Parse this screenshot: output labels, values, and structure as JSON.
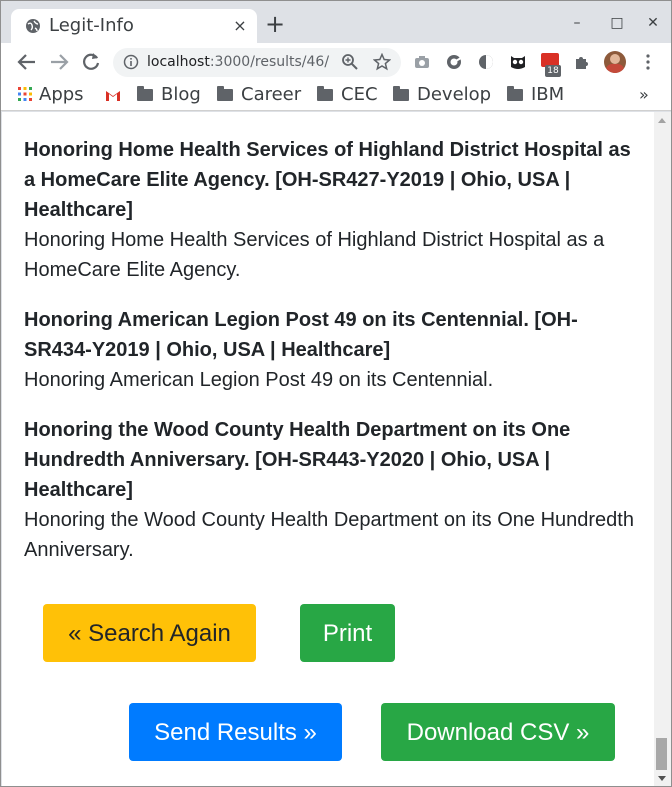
{
  "browser": {
    "tab_title": "Legit-Info",
    "tab_close_glyph": "×",
    "new_tab_glyph": "+",
    "url_host": "localhost",
    "url_path": ":3000/results/46/",
    "extension_badge": "18",
    "window_controls": {
      "minimize": "–",
      "maximize": "□",
      "close": "✕"
    },
    "bookmarks": {
      "apps": "Apps",
      "items": [
        "Blog",
        "Career",
        "CEC",
        "Develop",
        "IBM"
      ],
      "overflow": "»"
    },
    "icons": {
      "back": "arrow-left-icon",
      "forward": "arrow-right-icon",
      "reload": "reload-icon",
      "info": "info-icon",
      "zoom": "zoom-icon",
      "bookmark_star": "star-icon",
      "extensions": "puzzle-icon"
    }
  },
  "results": [
    {
      "title": "Honoring Home Health Services of Highland District Hospital as a HomeCare Elite Agency. [OH-SR427-Y2019 | Ohio, USA | Healthcare]",
      "summary": "Honoring Home Health Services of Highland District Hospital as a HomeCare Elite Agency."
    },
    {
      "title": "Honoring American Legion Post 49 on its Centennial. [OH-SR434-Y2019 | Ohio, USA | Healthcare]",
      "summary": "Honoring American Legion Post 49 on its Centennial."
    },
    {
      "title": "Honoring the Wood County Health Department on its One Hundredth Anniversary. [OH-SR443-Y2020 | Ohio, USA | Healthcare]",
      "summary": "Honoring the Wood County Health Department on its One Hundredth Anniversary."
    }
  ],
  "actions": {
    "search_again": "« Search Again",
    "print": "Print",
    "send_results": "Send Results »",
    "download_csv": "Download CSV »"
  },
  "colors": {
    "warning": "#ffc107",
    "success": "#28a745",
    "primary": "#007bff",
    "text": "#212529"
  }
}
